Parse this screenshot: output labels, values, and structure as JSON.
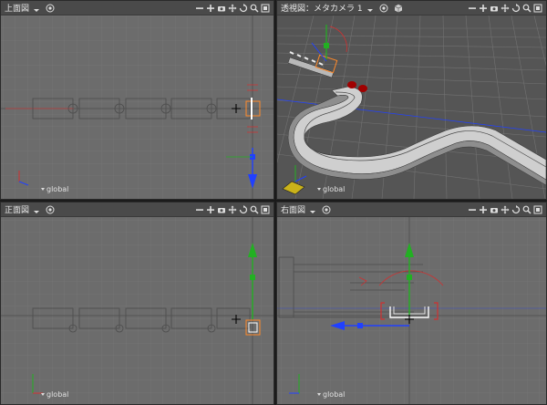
{
  "viewports": {
    "top": {
      "title": "上面図",
      "space_label": "global"
    },
    "perspective": {
      "title": "透視図：メタカメラ 1",
      "space_label": "global"
    },
    "front": {
      "title": "正面図",
      "space_label": "global"
    },
    "right": {
      "title": "右面図",
      "space_label": "global"
    }
  },
  "toolbar_icons": [
    "zoom-out-icon",
    "zoom-in-icon",
    "camera-icon",
    "move-view-icon",
    "rotate-view-icon",
    "magnify-icon",
    "fit-view-icon"
  ],
  "axis_colors": {
    "x": "#d03030",
    "y": "#22b022",
    "z": "#2040ff"
  },
  "selection_color": "#ff8a2a"
}
